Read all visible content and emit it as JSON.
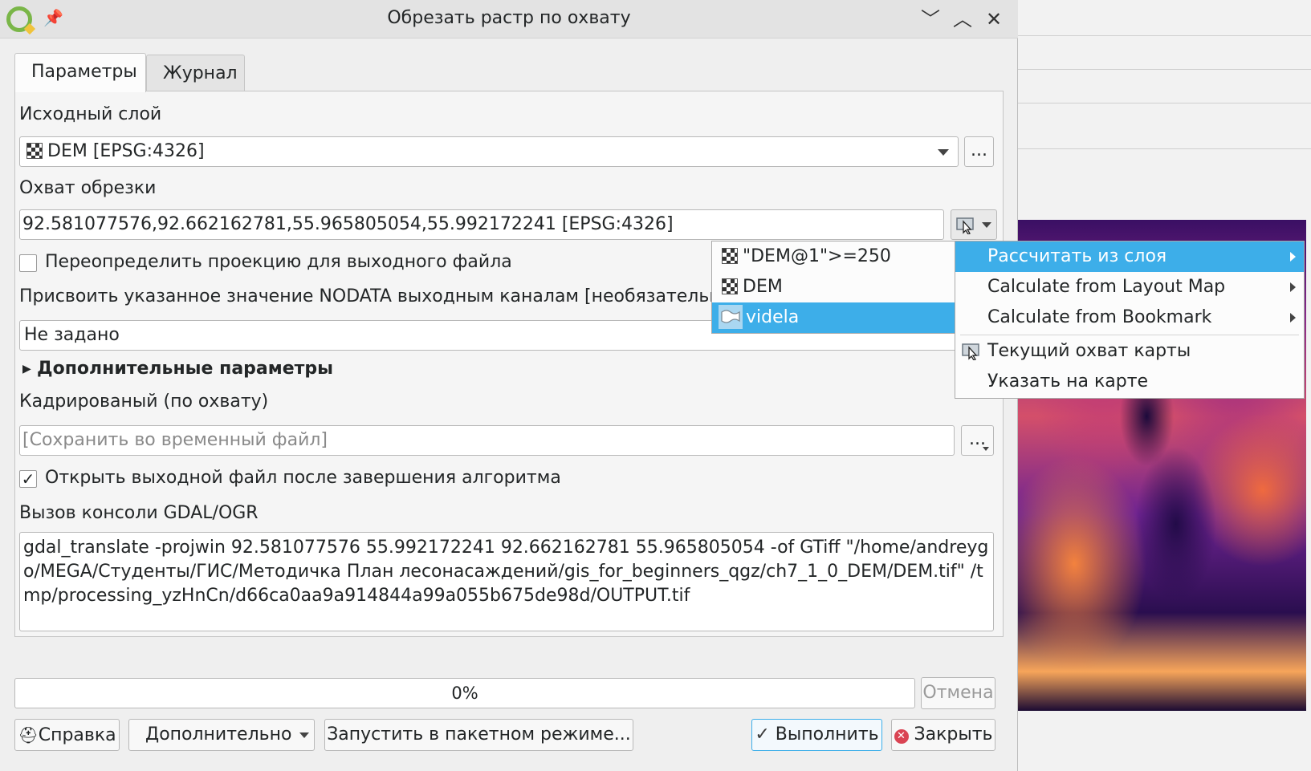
{
  "window": {
    "title": "Обрезать растр по охвату",
    "minimize_glyph": "﹀",
    "maximize_glyph": "︿",
    "close_glyph": "✕",
    "pin_glyph": "📌"
  },
  "tabs": [
    {
      "label": "Параметры",
      "active": true
    },
    {
      "label": "Журнал",
      "active": false
    }
  ],
  "params": {
    "input_layer_label": "Исходный слой",
    "input_layer_value": "DEM [EPSG:4326]",
    "browse_label": "...",
    "extent_label": "Охват обрезки",
    "extent_value": "92.581077576,92.662162781,55.965805054,55.992172241 [EPSG:4326]",
    "override_crs_label": "Переопределить проекцию для выходного файла",
    "override_crs_checked": false,
    "nodata_label": "Присвоить указанное значение NODATA выходным каналам [необязательно]",
    "nodata_value": "Не задано",
    "advanced_label": "Дополнительные параметры",
    "output_label": "Кадрированый (по охвату)",
    "output_placeholder": "[Сохранить во временный файл]",
    "open_output_label": "Открыть выходной файл после завершения алгоритма",
    "open_output_checked": true,
    "checkmark": "✓",
    "gdal_label": "Вызов консоли GDAL/OGR",
    "gdal_command": "gdal_translate -projwin 92.581077576 55.992172241 92.662162781 55.965805054 -of GTiff \"/home/andreygo/MEGA/Студенты/ГИС/Методичка План лесонасаждений/gis_for_beginners_qgz/ch7_1_0_DEM/DEM.tif\" /tmp/processing_yzHnCn/d66ca0aa9a914844a99a055b675de98d/OUTPUT.tif"
  },
  "progress": {
    "text": "0%",
    "value": 0,
    "cancel_label": "Отмена"
  },
  "footer": {
    "help_label": "Справка",
    "advanced_label": "Дополнительно",
    "batch_label": "Запустить в пакетном режиме...",
    "run_label": "Выполнить",
    "close_label": "Закрыть"
  },
  "layer_list": [
    {
      "label": "\"DEM@1\">=250",
      "icon": "raster-icon",
      "selected": false
    },
    {
      "label": "DEM",
      "icon": "raster-icon",
      "selected": false
    },
    {
      "label": "videla",
      "icon": "polygon-layer-icon",
      "selected": true
    }
  ],
  "context_menu": [
    {
      "label": "Рассчитать из слоя",
      "submenu": true,
      "highlighted": true
    },
    {
      "label": "Calculate from Layout Map",
      "submenu": true,
      "highlighted": false
    },
    {
      "label": "Calculate from Bookmark",
      "submenu": true,
      "highlighted": false
    },
    {
      "label": "Текущий охват карты",
      "submenu": false,
      "highlighted": false,
      "icon": "map-cursor-icon"
    },
    {
      "label": "Указать на карте",
      "submenu": false,
      "highlighted": false
    }
  ],
  "colors": {
    "accent": "#3daee9",
    "close_icon_red": "#da4453"
  }
}
